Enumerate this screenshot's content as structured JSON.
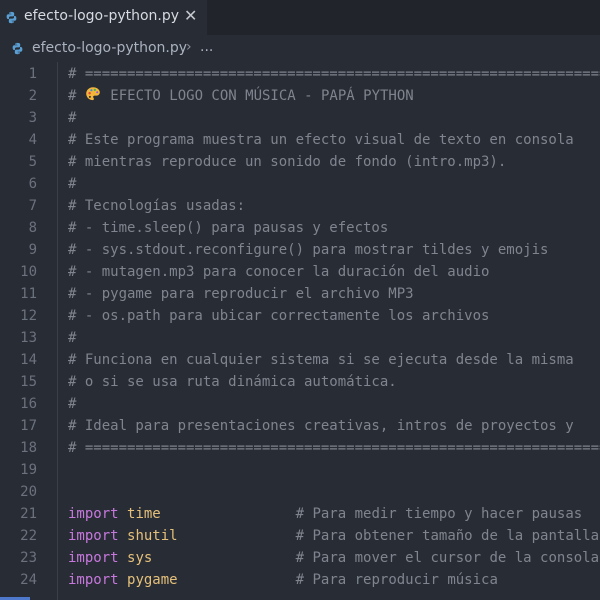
{
  "tab": {
    "label": "efecto-logo-python.py",
    "close_glyph": "✕",
    "icon": "python-icon"
  },
  "breadcrumb": {
    "file": "efecto-logo-python.py",
    "separator": "›",
    "more": "..."
  },
  "colors": {
    "background": "#282c34",
    "tabbar": "#21252b",
    "comment": "#7f848e",
    "keyword": "#c678dd",
    "module": "#e5c07b",
    "line_number": "#6b717d"
  },
  "lines": [
    {
      "n": "1",
      "comment": "# ================================================================"
    },
    {
      "n": "2",
      "comment_prefix": "# ",
      "emoji": "palette-icon",
      "comment_rest": " EFECTO LOGO CON MÚSICA - PAPÁ PYTHON"
    },
    {
      "n": "3",
      "comment": "#"
    },
    {
      "n": "4",
      "comment": "# Este programa muestra un efecto visual de texto en consola"
    },
    {
      "n": "5",
      "comment": "# mientras reproduce un sonido de fondo (intro.mp3)."
    },
    {
      "n": "6",
      "comment": "#"
    },
    {
      "n": "7",
      "comment": "# Tecnologías usadas:"
    },
    {
      "n": "8",
      "comment": "# - time.sleep() para pausas y efectos"
    },
    {
      "n": "9",
      "comment": "# - sys.stdout.reconfigure() para mostrar tildes y emojis"
    },
    {
      "n": "10",
      "comment": "# - mutagen.mp3 para conocer la duración del audio"
    },
    {
      "n": "11",
      "comment": "# - pygame para reproducir el archivo MP3"
    },
    {
      "n": "12",
      "comment": "# - os.path para ubicar correctamente los archivos"
    },
    {
      "n": "13",
      "comment": "#"
    },
    {
      "n": "14",
      "comment": "# Funciona en cualquier sistema si se ejecuta desde la misma"
    },
    {
      "n": "15",
      "comment": "# o si se usa ruta dinámica automática."
    },
    {
      "n": "16",
      "comment": "#"
    },
    {
      "n": "17",
      "comment": "# Ideal para presentaciones creativas, intros de proyectos y"
    },
    {
      "n": "18",
      "comment": "# ================================================================"
    },
    {
      "n": "19",
      "comment": ""
    },
    {
      "n": "20",
      "comment": ""
    },
    {
      "n": "21",
      "keyword": "import",
      "module": "time",
      "pad": "                ",
      "trail": "# Para medir tiempo y hacer pausas"
    },
    {
      "n": "22",
      "keyword": "import",
      "module": "shutil",
      "pad": "              ",
      "trail": "# Para obtener tamaño de la pantalla"
    },
    {
      "n": "23",
      "keyword": "import",
      "module": "sys",
      "pad": "                 ",
      "trail": "# Para mover el cursor de la consola"
    },
    {
      "n": "24",
      "keyword": "import",
      "module": "pygame",
      "pad": "              ",
      "trail": "# Para reproducir música"
    }
  ]
}
